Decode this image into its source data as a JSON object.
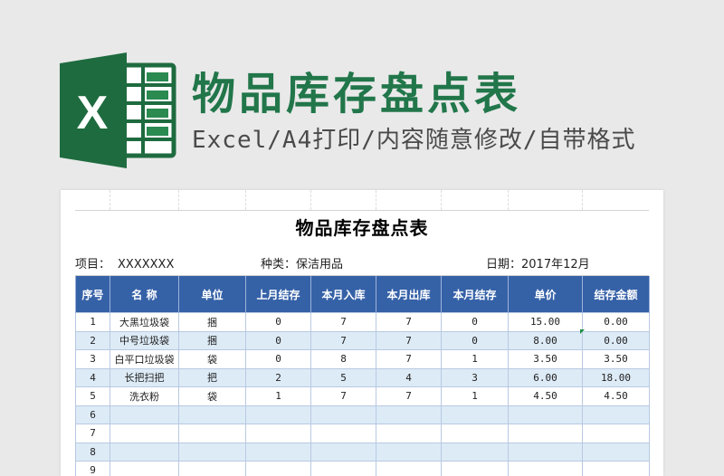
{
  "banner": {
    "logo_letter": "X",
    "title": "物品库存盘点表",
    "subtitle": "Excel/A4打印/内容随意修改/自带格式",
    "colors": {
      "title": "#21764a",
      "logo_dark": "#1e6b3f",
      "logo_mid": "#2a8a50"
    },
    "logo_icon": "excel-logo-icon"
  },
  "sheet": {
    "title": "物品库存盘点表",
    "project_label": "项目：",
    "project_value": "XXXXXXX",
    "category_label": "种类：",
    "category_value": "保洁用品",
    "date_label": "日期：",
    "date_value": "2017年12月",
    "header_color": "#3561a7",
    "stripe_color": "#ddebf7",
    "columns": [
      "序号",
      "名 称",
      "单位",
      "上月结存",
      "本月入库",
      "本月出库",
      "本月结存",
      "单价",
      "结存金额"
    ],
    "rows": [
      [
        "1",
        "大黑垃圾袋",
        "捆",
        "0",
        "7",
        "7",
        "0",
        "15.00",
        "0.00"
      ],
      [
        "2",
        "中号垃圾袋",
        "捆",
        "0",
        "7",
        "7",
        "0",
        "8.00",
        "0.00"
      ],
      [
        "3",
        "白平口垃圾袋",
        "袋",
        "0",
        "8",
        "7",
        "1",
        "3.50",
        "3.50"
      ],
      [
        "4",
        "长把扫把",
        "把",
        "2",
        "5",
        "4",
        "3",
        "6.00",
        "18.00"
      ],
      [
        "5",
        "洗衣粉",
        "袋",
        "1",
        "7",
        "7",
        "1",
        "4.50",
        "4.50"
      ],
      [
        "6",
        "",
        "",
        "",
        "",
        "",
        "",
        "",
        ""
      ],
      [
        "7",
        "",
        "",
        "",
        "",
        "",
        "",
        "",
        ""
      ],
      [
        "8",
        "",
        "",
        "",
        "",
        "",
        "",
        "",
        ""
      ],
      [
        "9",
        "",
        "",
        "",
        "",
        "",
        "",
        "",
        ""
      ]
    ]
  }
}
